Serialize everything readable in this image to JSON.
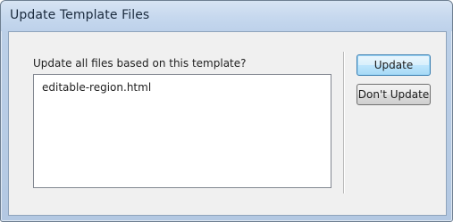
{
  "window": {
    "title": "Update Template Files"
  },
  "dialog": {
    "prompt": "Update all files based on this template?",
    "files": [
      "editable-region.html"
    ]
  },
  "buttons": {
    "update_label": "Update",
    "dont_update_label": "Don't Update"
  },
  "colors": {
    "titlebar": "#c6d8ee",
    "client_background": "#f0f0f0",
    "default_button_border": "#3c7fb1"
  }
}
